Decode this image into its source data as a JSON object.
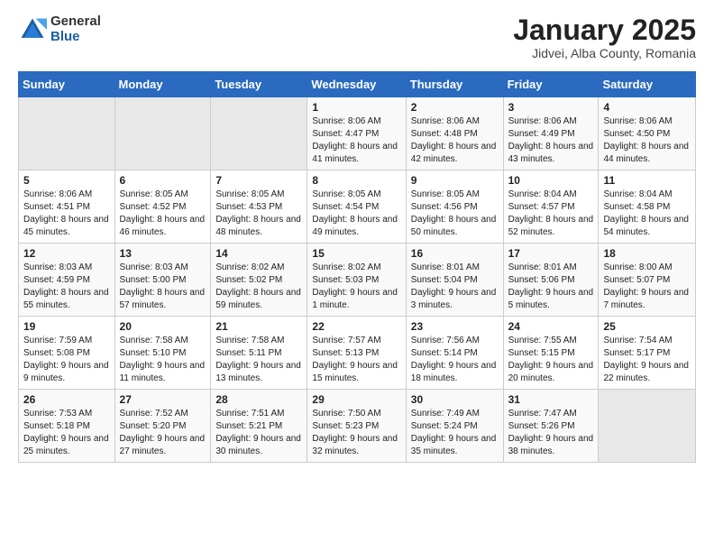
{
  "logo": {
    "general": "General",
    "blue": "Blue"
  },
  "title": "January 2025",
  "location": "Jidvei, Alba County, Romania",
  "days_header": [
    "Sunday",
    "Monday",
    "Tuesday",
    "Wednesday",
    "Thursday",
    "Friday",
    "Saturday"
  ],
  "weeks": [
    [
      {
        "day": "",
        "content": ""
      },
      {
        "day": "",
        "content": ""
      },
      {
        "day": "",
        "content": ""
      },
      {
        "day": "1",
        "content": "Sunrise: 8:06 AM\nSunset: 4:47 PM\nDaylight: 8 hours and 41 minutes."
      },
      {
        "day": "2",
        "content": "Sunrise: 8:06 AM\nSunset: 4:48 PM\nDaylight: 8 hours and 42 minutes."
      },
      {
        "day": "3",
        "content": "Sunrise: 8:06 AM\nSunset: 4:49 PM\nDaylight: 8 hours and 43 minutes."
      },
      {
        "day": "4",
        "content": "Sunrise: 8:06 AM\nSunset: 4:50 PM\nDaylight: 8 hours and 44 minutes."
      }
    ],
    [
      {
        "day": "5",
        "content": "Sunrise: 8:06 AM\nSunset: 4:51 PM\nDaylight: 8 hours and 45 minutes."
      },
      {
        "day": "6",
        "content": "Sunrise: 8:05 AM\nSunset: 4:52 PM\nDaylight: 8 hours and 46 minutes."
      },
      {
        "day": "7",
        "content": "Sunrise: 8:05 AM\nSunset: 4:53 PM\nDaylight: 8 hours and 48 minutes."
      },
      {
        "day": "8",
        "content": "Sunrise: 8:05 AM\nSunset: 4:54 PM\nDaylight: 8 hours and 49 minutes."
      },
      {
        "day": "9",
        "content": "Sunrise: 8:05 AM\nSunset: 4:56 PM\nDaylight: 8 hours and 50 minutes."
      },
      {
        "day": "10",
        "content": "Sunrise: 8:04 AM\nSunset: 4:57 PM\nDaylight: 8 hours and 52 minutes."
      },
      {
        "day": "11",
        "content": "Sunrise: 8:04 AM\nSunset: 4:58 PM\nDaylight: 8 hours and 54 minutes."
      }
    ],
    [
      {
        "day": "12",
        "content": "Sunrise: 8:03 AM\nSunset: 4:59 PM\nDaylight: 8 hours and 55 minutes."
      },
      {
        "day": "13",
        "content": "Sunrise: 8:03 AM\nSunset: 5:00 PM\nDaylight: 8 hours and 57 minutes."
      },
      {
        "day": "14",
        "content": "Sunrise: 8:02 AM\nSunset: 5:02 PM\nDaylight: 8 hours and 59 minutes."
      },
      {
        "day": "15",
        "content": "Sunrise: 8:02 AM\nSunset: 5:03 PM\nDaylight: 9 hours and 1 minute."
      },
      {
        "day": "16",
        "content": "Sunrise: 8:01 AM\nSunset: 5:04 PM\nDaylight: 9 hours and 3 minutes."
      },
      {
        "day": "17",
        "content": "Sunrise: 8:01 AM\nSunset: 5:06 PM\nDaylight: 9 hours and 5 minutes."
      },
      {
        "day": "18",
        "content": "Sunrise: 8:00 AM\nSunset: 5:07 PM\nDaylight: 9 hours and 7 minutes."
      }
    ],
    [
      {
        "day": "19",
        "content": "Sunrise: 7:59 AM\nSunset: 5:08 PM\nDaylight: 9 hours and 9 minutes."
      },
      {
        "day": "20",
        "content": "Sunrise: 7:58 AM\nSunset: 5:10 PM\nDaylight: 9 hours and 11 minutes."
      },
      {
        "day": "21",
        "content": "Sunrise: 7:58 AM\nSunset: 5:11 PM\nDaylight: 9 hours and 13 minutes."
      },
      {
        "day": "22",
        "content": "Sunrise: 7:57 AM\nSunset: 5:13 PM\nDaylight: 9 hours and 15 minutes."
      },
      {
        "day": "23",
        "content": "Sunrise: 7:56 AM\nSunset: 5:14 PM\nDaylight: 9 hours and 18 minutes."
      },
      {
        "day": "24",
        "content": "Sunrise: 7:55 AM\nSunset: 5:15 PM\nDaylight: 9 hours and 20 minutes."
      },
      {
        "day": "25",
        "content": "Sunrise: 7:54 AM\nSunset: 5:17 PM\nDaylight: 9 hours and 22 minutes."
      }
    ],
    [
      {
        "day": "26",
        "content": "Sunrise: 7:53 AM\nSunset: 5:18 PM\nDaylight: 9 hours and 25 minutes."
      },
      {
        "day": "27",
        "content": "Sunrise: 7:52 AM\nSunset: 5:20 PM\nDaylight: 9 hours and 27 minutes."
      },
      {
        "day": "28",
        "content": "Sunrise: 7:51 AM\nSunset: 5:21 PM\nDaylight: 9 hours and 30 minutes."
      },
      {
        "day": "29",
        "content": "Sunrise: 7:50 AM\nSunset: 5:23 PM\nDaylight: 9 hours and 32 minutes."
      },
      {
        "day": "30",
        "content": "Sunrise: 7:49 AM\nSunset: 5:24 PM\nDaylight: 9 hours and 35 minutes."
      },
      {
        "day": "31",
        "content": "Sunrise: 7:47 AM\nSunset: 5:26 PM\nDaylight: 9 hours and 38 minutes."
      },
      {
        "day": "",
        "content": ""
      }
    ]
  ]
}
